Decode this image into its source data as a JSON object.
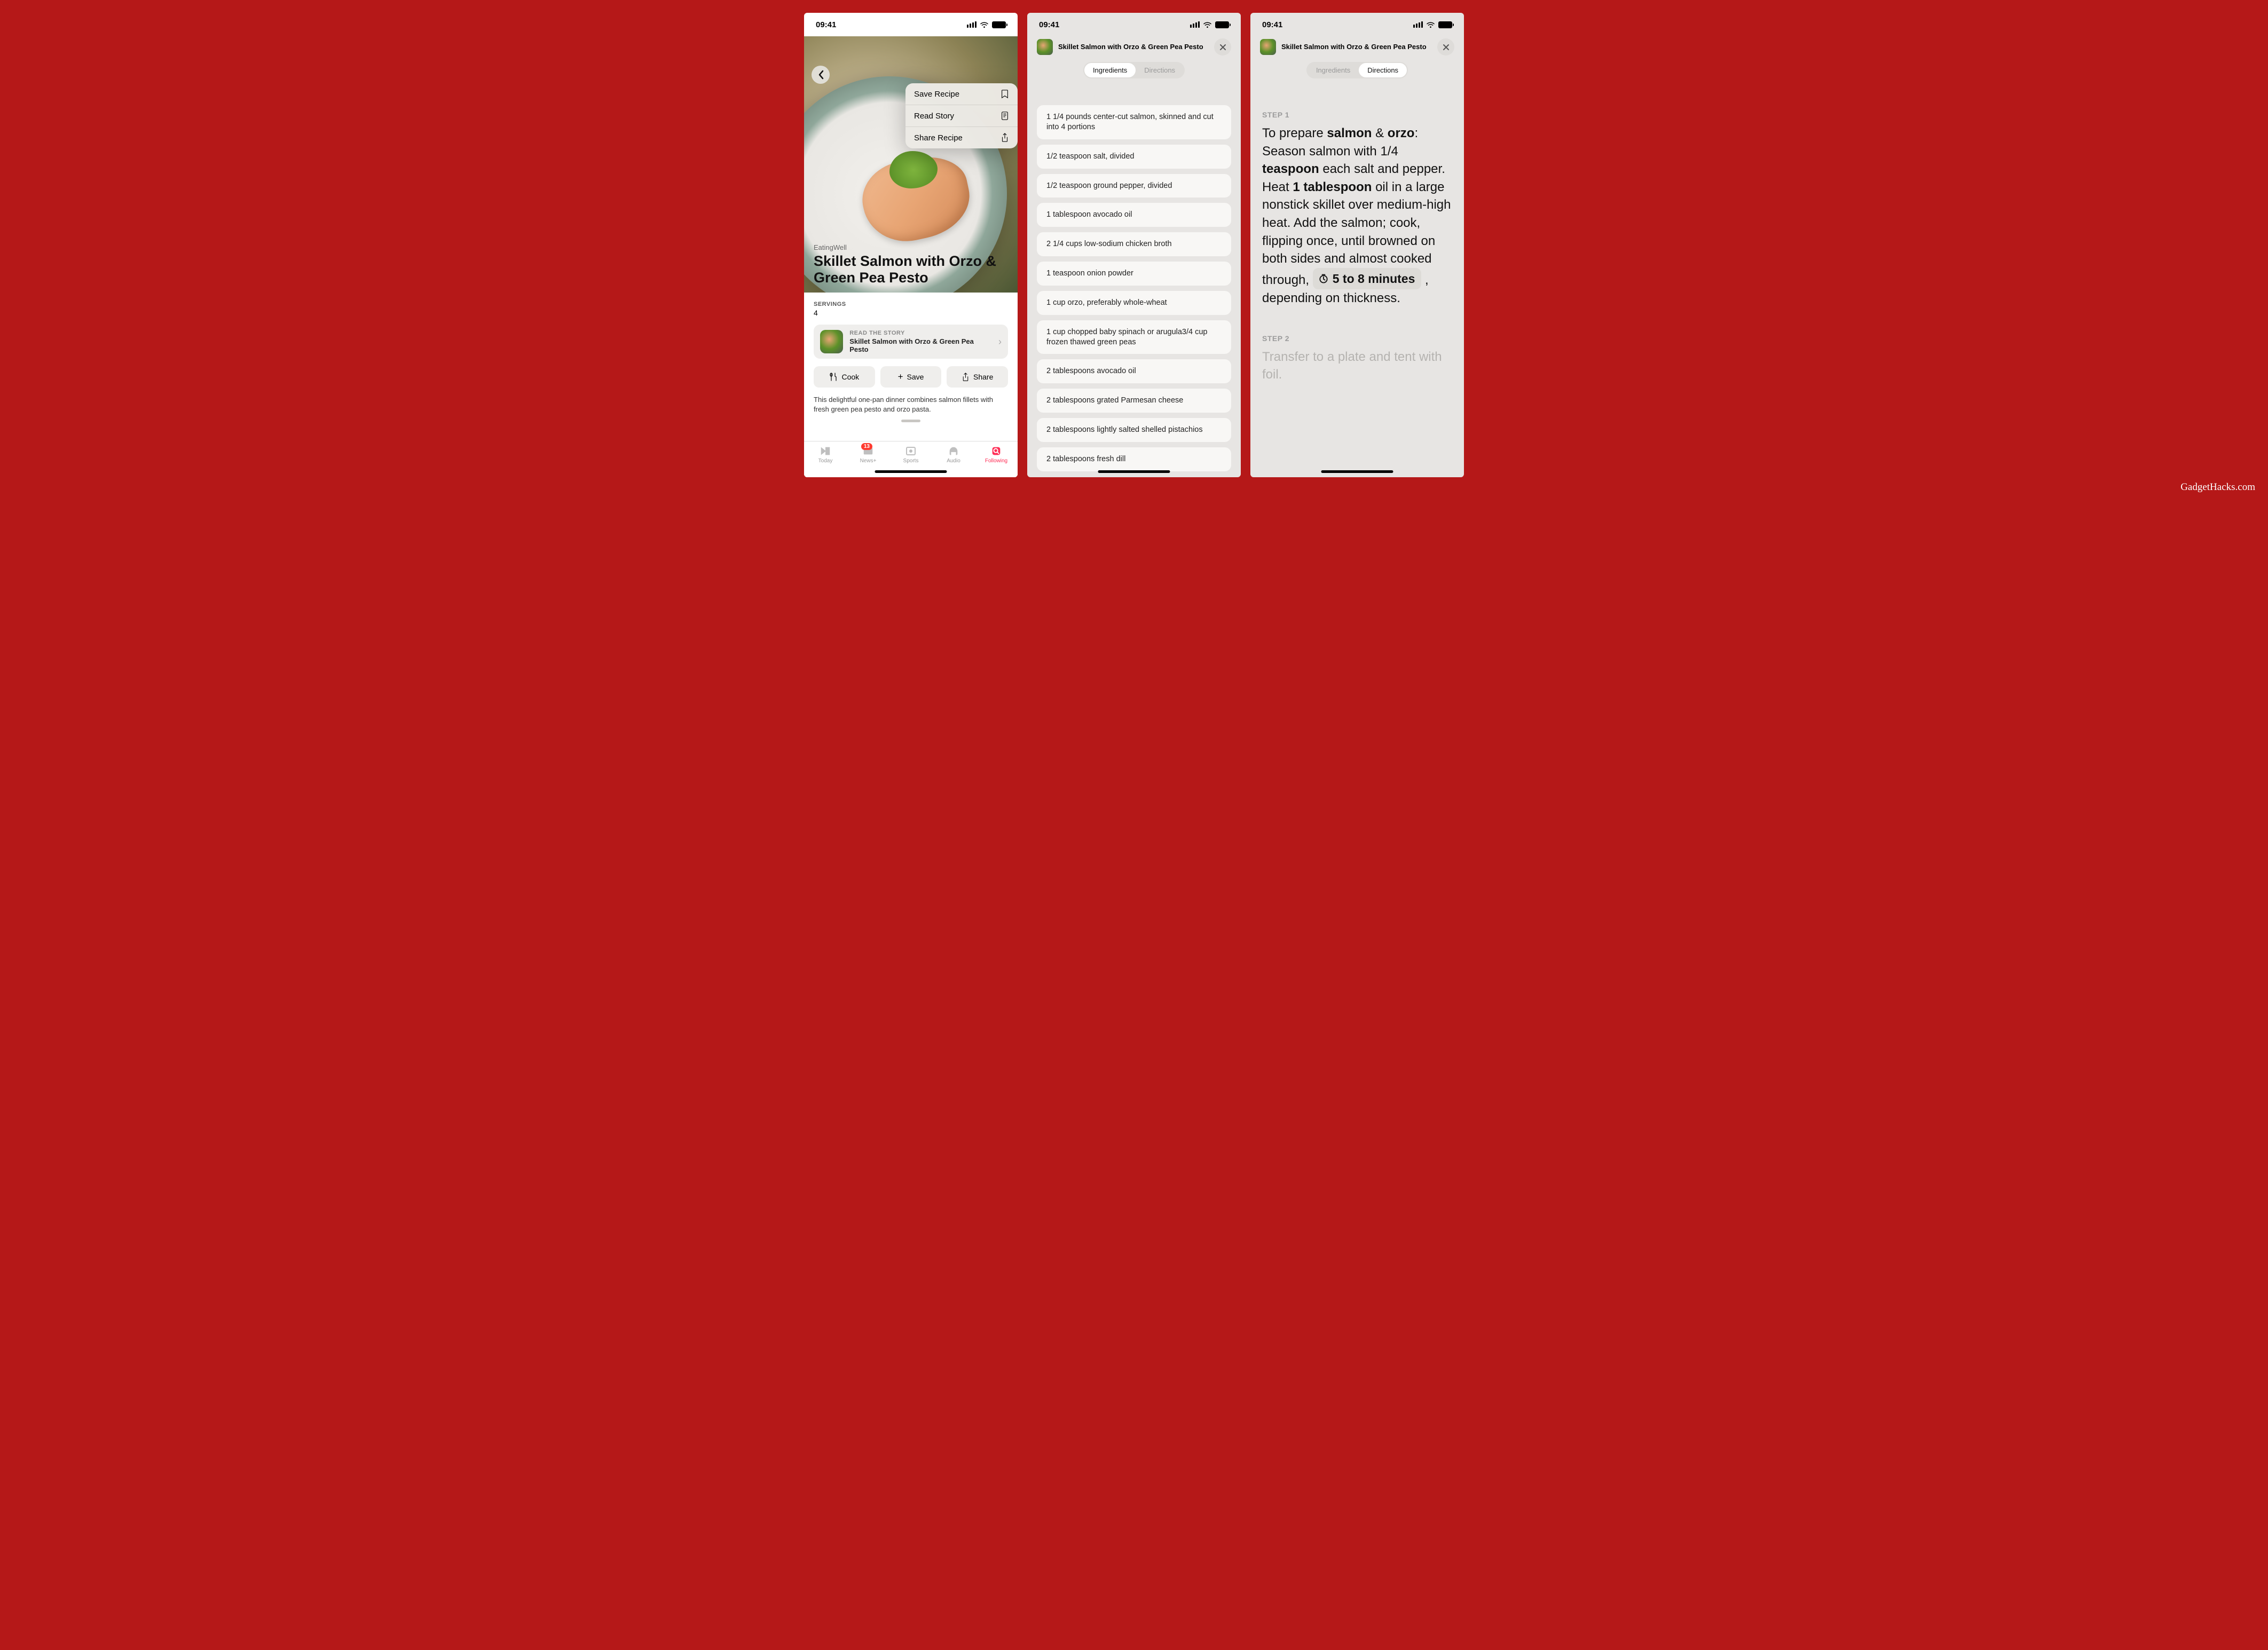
{
  "status": {
    "time": "09:41"
  },
  "phone1": {
    "menu": {
      "save": "Save Recipe",
      "read": "Read Story",
      "share": "Share Recipe"
    },
    "publisher": "EatingWell",
    "title": "Skillet Salmon with Orzo & Green Pea Pesto",
    "servings_label": "SERVINGS",
    "servings_value": "4",
    "storycard": {
      "label": "READ THE STORY",
      "name": "Skillet Salmon with Orzo & Green Pea Pesto"
    },
    "buttons": {
      "cook": "Cook",
      "save": "Save",
      "share": "Share"
    },
    "description": "This delightful one-pan dinner combines salmon fillets with fresh green pea pesto and orzo pasta.",
    "tabs": {
      "today": "Today",
      "newsplus": "News+",
      "newsplus_badge": "13",
      "sports": "Sports",
      "audio": "Audio",
      "following": "Following"
    }
  },
  "recipe_header": {
    "title": "Skillet Salmon with Orzo & Green Pea Pesto",
    "seg_ingredients": "Ingredients",
    "seg_directions": "Directions"
  },
  "ingredients": [
    "1 1/4 pounds center-cut salmon, skinned and cut into 4 portions",
    "1/2 teaspoon salt, divided",
    "1/2 teaspoon ground pepper, divided",
    "1 tablespoon avocado oil",
    "2 1/4 cups low-sodium chicken broth",
    "1 teaspoon onion powder",
    "1 cup orzo, preferably whole-wheat",
    "1 cup chopped baby spinach or arugula3/4 cup frozen thawed green peas",
    "2 tablespoons avocado oil",
    "2 tablespoons grated Parmesan cheese",
    "2 tablespoons lightly salted shelled pistachios",
    "2 tablespoons fresh dill"
  ],
  "directions": {
    "step1_label": "STEP 1",
    "step1_pre": "To prepare ",
    "step1_b1": "salmon",
    "step1_amp": " & ",
    "step1_b2": "orzo",
    "step1_after_orzo": ": Season salmon with 1/4 ",
    "step1_b3": "teaspoon",
    "step1_after_tsp": " each salt and pepper. Heat ",
    "step1_b4": "1 tablespoon",
    "step1_after_tbsp": " oil in a large nonstick skillet over medium-high heat. Add the salmon; cook, flipping once, until browned on both sides and almost cooked through, ",
    "step1_timer": "5 to 8 minutes",
    "step1_tail": " , depending on thickness.",
    "step2_label": "STEP 2",
    "step2_text": "Transfer to a plate and tent with foil."
  },
  "watermark": "GadgetHacks.com"
}
